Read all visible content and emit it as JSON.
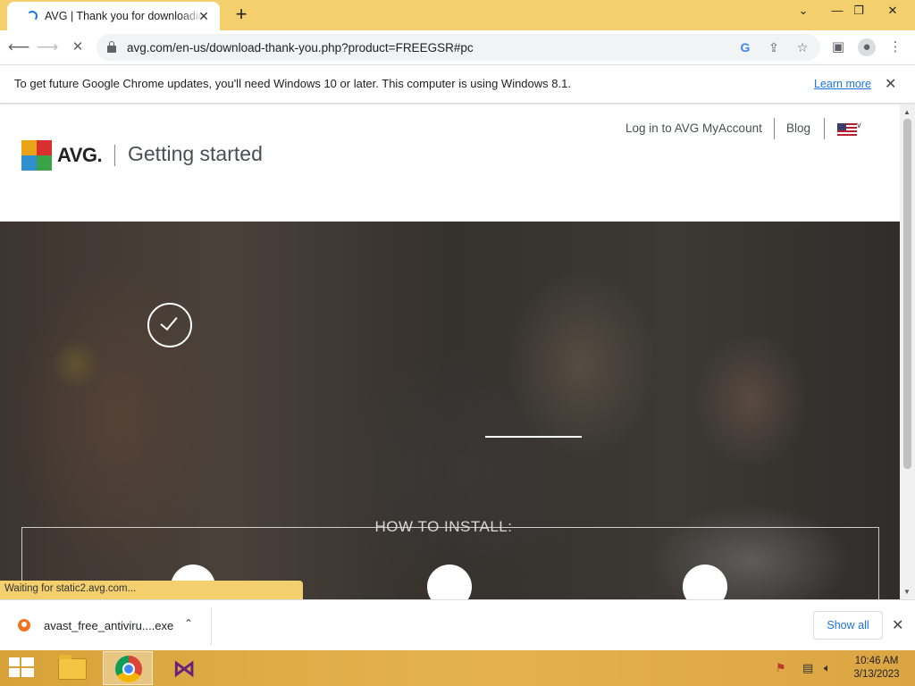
{
  "browser": {
    "tab_title": "AVG | Thank you for downloading",
    "tab_close_glyph": "✕",
    "new_tab_glyph": "+",
    "url": "avg.com/en-us/download-thank-you.php?product=FREEGSR#pc",
    "window_controls": {
      "dropdown": "⌄",
      "minimize": "—",
      "restore": "❐",
      "close": "✕"
    }
  },
  "infobar": {
    "message": "To get future Google Chrome updates, you'll need Windows 10 or later. This computer is using Windows 8.1.",
    "link": "Learn more"
  },
  "page": {
    "logo_text": "AVG.",
    "heading": "Getting started",
    "nav": {
      "account": "Log in to AVG MyAccount",
      "blog": "Blog"
    },
    "install_title": "HOW TO INSTALL:"
  },
  "status_text": "Waiting for static2.avg.com...",
  "downloads": {
    "file_name": "avast_free_antiviru....exe",
    "show_all": "Show all"
  },
  "taskbar": {
    "time": "10:46 AM",
    "date": "3/13/2023"
  },
  "colors": {
    "chrome_frame": "#f3cf6d",
    "link_blue": "#1a73e8",
    "taskbar": "#e0ab47"
  }
}
